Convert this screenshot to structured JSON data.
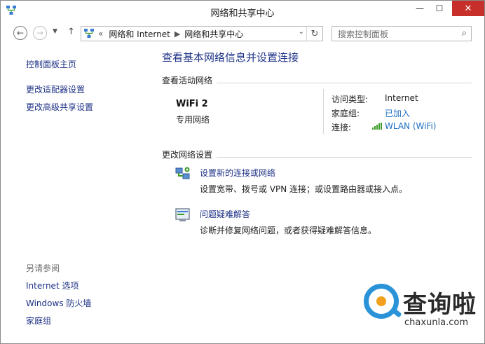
{
  "window": {
    "title": "网络和共享中心",
    "minimize_glyph": "—",
    "maximize_glyph": "☐",
    "close_glyph": "✕"
  },
  "nav": {
    "back_glyph": "←",
    "forward_glyph": "→",
    "history_glyph": "▼",
    "up_glyph": "↑",
    "address": {
      "prefix": "«",
      "crumbs": [
        "网络和 Internet",
        "网络和共享中心"
      ],
      "separator": "▶",
      "dropdown_glyph": "⌄",
      "refresh_glyph": "↻"
    },
    "search": {
      "placeholder": "搜索控制面板",
      "value": "",
      "icon_glyph": "⌕"
    }
  },
  "sidebar": {
    "home": "控制面板主页",
    "links": [
      "更改适配器设置",
      "更改高级共享设置"
    ],
    "see_also_heading": "另请参阅",
    "see_also": [
      "Internet 选项",
      "Windows 防火墙",
      "家庭组"
    ]
  },
  "main": {
    "heading": "查看基本网络信息并设置连接",
    "active_networks_label": "查看活动网络",
    "network": {
      "name": "WiFi  2",
      "type": "专用网络",
      "access_type_label": "访问类型:",
      "access_type_value": "Internet",
      "homegroup_label": "家庭组:",
      "homegroup_value": "已加入",
      "connection_label": "连接:",
      "connection_value": "WLAN (WiFi)"
    },
    "change_settings_label": "更改网络设置",
    "tasks": [
      {
        "link": "设置新的连接或网络",
        "desc": "设置宽带、拨号或 VPN 连接；或设置路由器或接入点。"
      },
      {
        "link": "问题疑难解答",
        "desc": "诊断并修复网络问题，或者获得疑难解答信息。"
      }
    ]
  },
  "watermark": {
    "text": "查询啦",
    "url": "chaxunla.com"
  },
  "colors": {
    "link": "#1e3287",
    "link_bright": "#1e6fc1",
    "close_button": "#c7302a",
    "signal": "#3a9a25",
    "watermark_blue": "#2a93d8",
    "watermark_orange": "#f2a11c"
  }
}
